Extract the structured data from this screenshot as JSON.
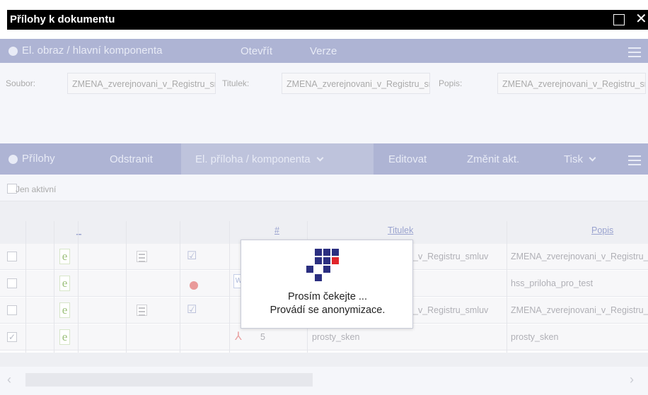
{
  "window": {
    "title": "Přílohy k dokumentu",
    "maximize_icon": "maximize-icon",
    "close_glyph": "✕"
  },
  "main_toolbar": {
    "section_label": "El. obraz / hlavní komponenta",
    "open_label": "Otevřít",
    "versions_label": "Verze",
    "menu_icon": "hamburger-icon"
  },
  "document_form": {
    "file_label": "Soubor:",
    "file_value": "ZMENA_zverejnovani_v_Registru_smluv",
    "title_label": "Titulek:",
    "title_value": "ZMENA_zverejnovani_v_Registru_smluv",
    "description_label": "Popis:",
    "description_value": "ZMENA_zverejnovani_v_Registru_smluv"
  },
  "attachments_toolbar": {
    "section_label": "Přílohy",
    "remove_label": "Odstranit",
    "el_attachment_label": "El. příloha / komponenta",
    "edit_label": "Editovat",
    "change_active_label": "Změnit akt.",
    "print_label": "Tisk",
    "menu_icon": "hamburger-icon"
  },
  "filter": {
    "only_active_label": "Jen aktivní"
  },
  "grid": {
    "columns": [
      "_",
      "#",
      "Titulek",
      "Popis"
    ],
    "rows": [
      {
        "checked": false,
        "number": "",
        "title": "_v_Registru_smluv",
        "description": "ZMENA_zverejnovani_v_Registru_smluv"
      },
      {
        "checked": false,
        "number": "",
        "title": "",
        "description": "hss_priloha_pro_test"
      },
      {
        "checked": false,
        "number": "",
        "title": "_v_Registru_smluv",
        "description": "ZMENA_zverejnovani_v_Registru_smluv"
      },
      {
        "checked": true,
        "number": "5",
        "title": "prosty_sken",
        "description": "prosty_sken"
      }
    ]
  },
  "scrollbar": {
    "left_glyph": "‹",
    "right_glyph": "›"
  },
  "loading_dialog": {
    "line1": "Prosím čekejte ...",
    "line2": "Provádí se anonymizace.",
    "colors": {
      "primary": "#2b2f80",
      "accent": "#e0252b"
    }
  }
}
